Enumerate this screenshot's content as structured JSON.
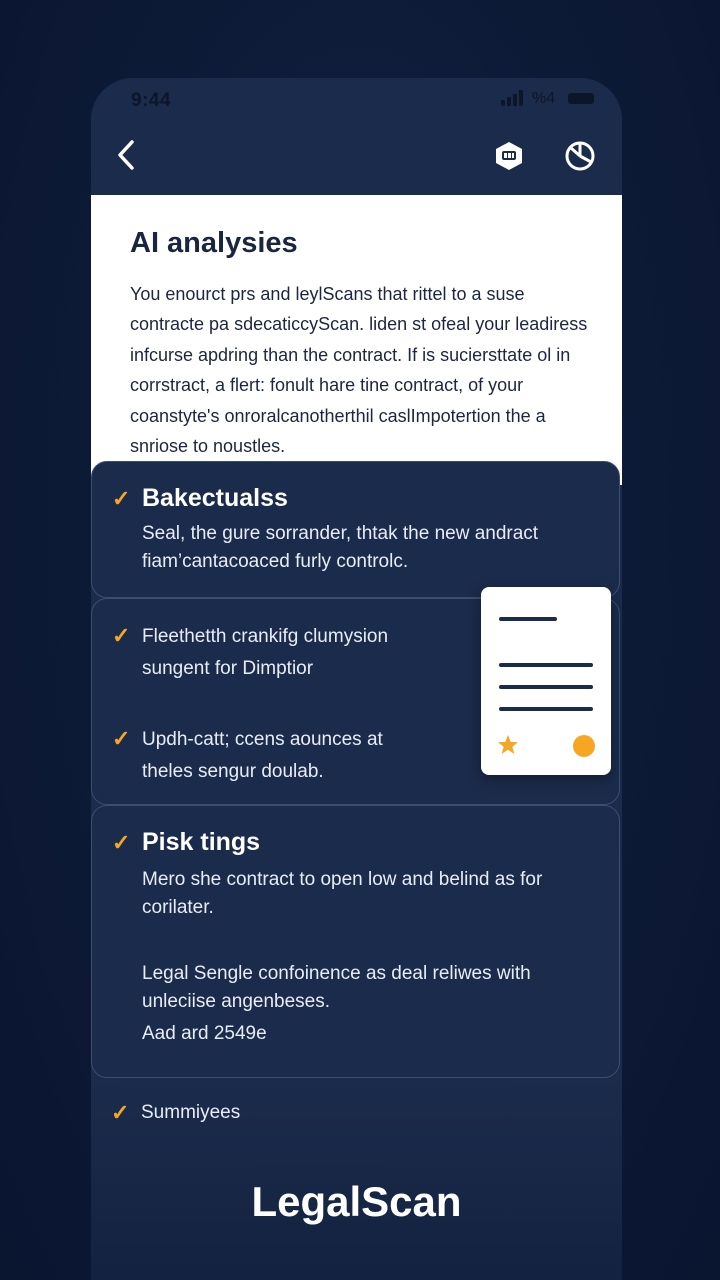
{
  "status": {
    "time": "9:44",
    "battery_pct": "%4"
  },
  "header": {
    "back_icon": "chevron-left-icon",
    "icons": [
      "shield-icon",
      "pie-chart-icon"
    ]
  },
  "intro": {
    "title": "AI analysies",
    "body": "You enourct prs and leylScans that rittel to a suse contracte pa sdecaticcyScan. liden st ofeal your leadiress infcurse apdring  than the contract.  If is suciersttate ol in corrstract, a flert: fonult hare tine contract, of your coanstyte's onroralcanotherthil caslImpotertion the a snriose to noustles."
  },
  "sections": {
    "backgrounds": {
      "title": "Bakectualss",
      "text": "Seal, the gure sorrander, thtak the new andract fiam’cantacoaced furly controlc."
    },
    "checks": {
      "item1": "Fleethetth crankifg clumysion sungent for Dimptior",
      "item2": "Updh-catt; ccens aounces at theles sengur doulab."
    },
    "risk": {
      "title": "Pisk tings",
      "text1": "Mero she contract to open low and belind as for corilater.",
      "text2": "Legal Sengle confoinence as deal reliwes with unleciise angenbeses.",
      "text3": "Aad ard 2549e"
    },
    "summary": {
      "label": "Summiyees"
    }
  },
  "brand": {
    "name": "LegalScan"
  },
  "colors": {
    "accent": "#f5a623",
    "card_bg": "#1b2b4b",
    "page_bg": "#0d1a36"
  }
}
